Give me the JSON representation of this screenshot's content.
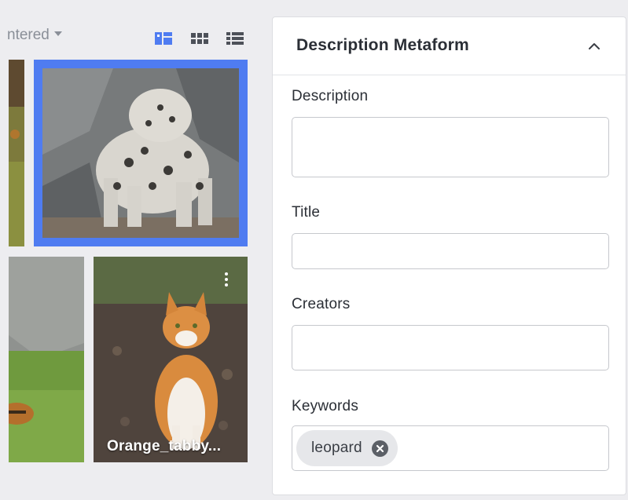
{
  "gallery": {
    "filter_label": "ntered",
    "view_modes": {
      "masonry_icon": "masonry-view-icon",
      "grid_icon": "grid-view-icon",
      "list_icon": "list-view-icon"
    },
    "items": [
      {
        "caption": "",
        "selected": false,
        "subject": "partial-tile"
      },
      {
        "caption": "",
        "selected": true,
        "subject": "snow-leopard"
      },
      {
        "caption": "",
        "selected": false,
        "subject": "partial-tile"
      },
      {
        "caption": "Orange_tabby...",
        "selected": false,
        "subject": "orange-tabby-cat"
      }
    ],
    "accent_color": "#4f7cf1"
  },
  "panel": {
    "title": "Description Metaform",
    "collapse_icon": "chevron-up-icon",
    "fields": {
      "description": {
        "label": "Description",
        "value": ""
      },
      "title": {
        "label": "Title",
        "value": ""
      },
      "creators": {
        "label": "Creators",
        "value": ""
      },
      "keywords": {
        "label": "Keywords",
        "tags": [
          "leopard"
        ],
        "remove_icon": "close-circle-icon"
      }
    }
  }
}
